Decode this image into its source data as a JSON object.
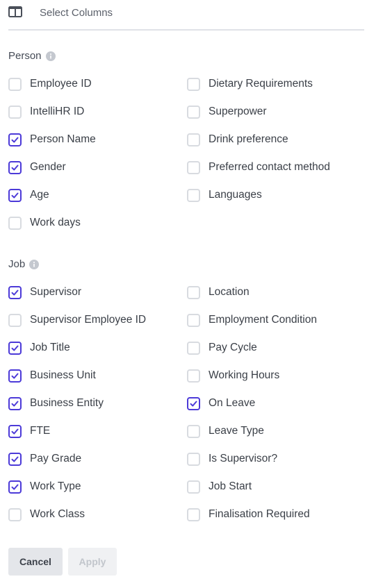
{
  "header": {
    "title": "Select Columns",
    "icon": "columns-icon"
  },
  "person": {
    "title": "Person",
    "left": [
      {
        "label": "Employee ID",
        "checked": false
      },
      {
        "label": "IntelliHR ID",
        "checked": false
      },
      {
        "label": "Person Name",
        "checked": true
      },
      {
        "label": "Gender",
        "checked": true
      },
      {
        "label": "Age",
        "checked": true
      },
      {
        "label": "Work days",
        "checked": false
      }
    ],
    "right": [
      {
        "label": "Dietary Requirements",
        "checked": false
      },
      {
        "label": "Superpower",
        "checked": false
      },
      {
        "label": "Drink preference",
        "checked": false
      },
      {
        "label": "Preferred contact method",
        "checked": false
      },
      {
        "label": "Languages",
        "checked": false
      }
    ]
  },
  "job": {
    "title": "Job",
    "left": [
      {
        "label": "Supervisor",
        "checked": true
      },
      {
        "label": "Supervisor Employee ID",
        "checked": false
      },
      {
        "label": "Job Title",
        "checked": true
      },
      {
        "label": "Business Unit",
        "checked": true
      },
      {
        "label": "Business Entity",
        "checked": true
      },
      {
        "label": "FTE",
        "checked": true
      },
      {
        "label": "Pay Grade",
        "checked": true
      },
      {
        "label": "Work Type",
        "checked": true
      },
      {
        "label": "Work Class",
        "checked": false
      }
    ],
    "right": [
      {
        "label": "Location",
        "checked": false
      },
      {
        "label": "Employment Condition",
        "checked": false
      },
      {
        "label": "Pay Cycle",
        "checked": false
      },
      {
        "label": "Working Hours",
        "checked": false
      },
      {
        "label": "On Leave",
        "checked": true
      },
      {
        "label": "Leave Type",
        "checked": false
      },
      {
        "label": "Is Supervisor?",
        "checked": false
      },
      {
        "label": "Job Start",
        "checked": false
      },
      {
        "label": "Finalisation Required",
        "checked": false
      }
    ]
  },
  "actions": {
    "cancel_label": "Cancel",
    "apply_label": "Apply"
  },
  "colors": {
    "accent": "#4c3ad8",
    "checkbox_border": "#d8dbe0",
    "divider": "#dfe2e7"
  }
}
